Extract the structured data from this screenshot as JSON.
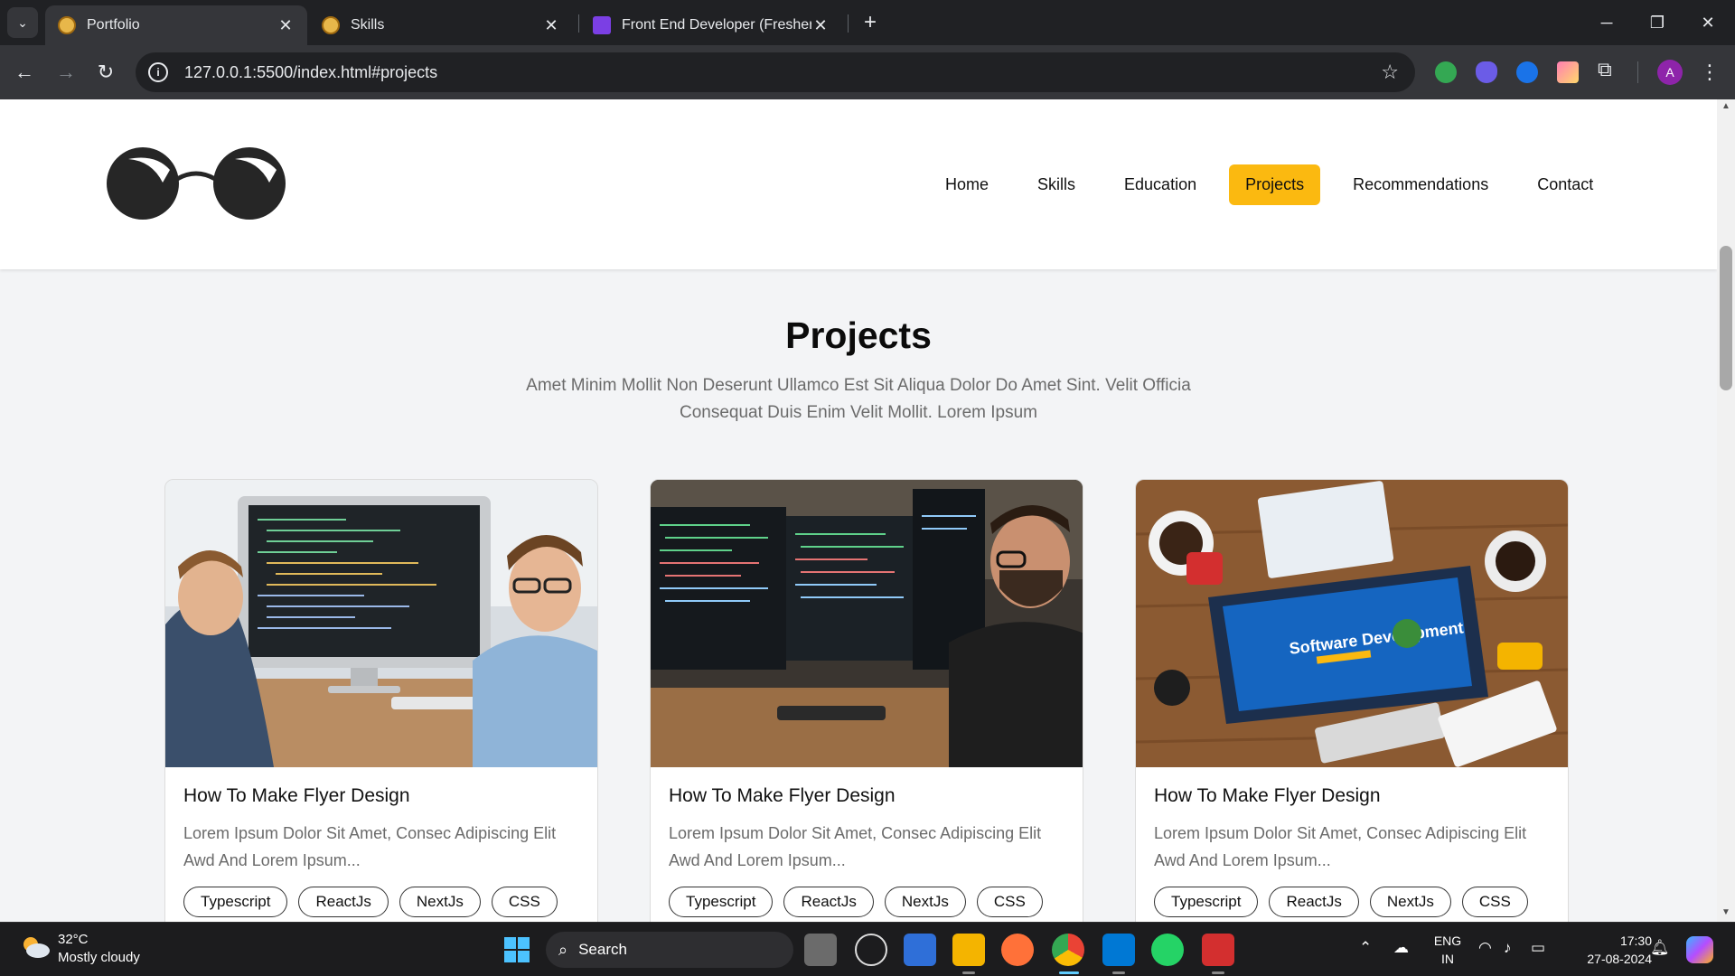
{
  "browser": {
    "tabs": [
      {
        "title": "Portfolio",
        "active": true
      },
      {
        "title": "Skills",
        "active": false
      },
      {
        "title": "Front End Developer (Fresher/In",
        "active": false
      }
    ],
    "url": "127.0.0.1:5500/index.html#projects"
  },
  "site": {
    "nav": [
      {
        "label": "Home",
        "active": false
      },
      {
        "label": "Skills",
        "active": false
      },
      {
        "label": "Education",
        "active": false
      },
      {
        "label": "Projects",
        "active": true
      },
      {
        "label": "Recommendations",
        "active": false
      },
      {
        "label": "Contact",
        "active": false
      }
    ],
    "accent": "#fbb910"
  },
  "projects": {
    "title": "Projects",
    "subtitle": "Amet Minim Mollit Non Deserunt Ullamco Est Sit Aliqua Dolor Do Amet Sint. Velit Officia Consequat Duis Enim Velit Mollit. Lorem Ipsum",
    "cards": [
      {
        "title": "How To Make Flyer Design",
        "desc": "Lorem Ipsum Dolor Sit Amet, Consec Adipiscing Elit Awd And Lorem Ipsum...",
        "tags": [
          "Typescript",
          "ReactJs",
          "NextJs",
          "CSS"
        ]
      },
      {
        "title": "How To Make Flyer Design",
        "desc": "Lorem Ipsum Dolor Sit Amet, Consec Adipiscing Elit Awd And Lorem Ipsum...",
        "tags": [
          "Typescript",
          "ReactJs",
          "NextJs",
          "CSS"
        ]
      },
      {
        "title": "How To Make Flyer Design",
        "desc": "Lorem Ipsum Dolor Sit Amet, Consec Adipiscing Elit Awd And Lorem Ipsum...",
        "tags": [
          "Typescript",
          "ReactJs",
          "NextJs",
          "CSS"
        ]
      }
    ],
    "card3_banner": "Software Development"
  },
  "taskbar": {
    "weather_temp": "32°C",
    "weather_desc": "Mostly cloudy",
    "search_label": "Search",
    "lang_line1": "ENG",
    "lang_line2": "IN",
    "time": "17:30",
    "date": "27-08-2024"
  }
}
